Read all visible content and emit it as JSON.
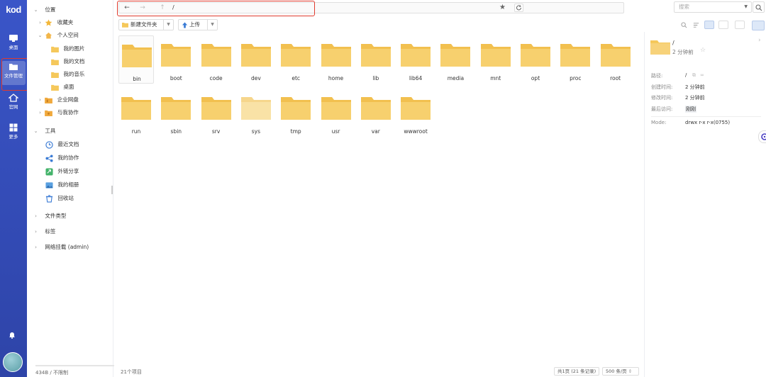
{
  "app": {
    "logo": "kod"
  },
  "rail": {
    "items": [
      {
        "label": "桌面",
        "icon": "desktop-icon"
      },
      {
        "label": "文件管理",
        "icon": "folder-icon"
      },
      {
        "label": "官网",
        "icon": "home-icon"
      },
      {
        "label": "更多",
        "icon": "grid-icon"
      }
    ]
  },
  "tree": {
    "location_label": "位置",
    "favorites": "收藏夹",
    "personal_space": "个人空间",
    "personal_children": [
      "我的图片",
      "我的文档",
      "我的音乐",
      "桌面"
    ],
    "enterprise_disk": "企业网盘",
    "shared_with_me": "与我协作",
    "tools_label": "工具",
    "tools": [
      "最近文档",
      "我的协作",
      "外链分享",
      "我的相册",
      "回收站"
    ],
    "file_types": "文件类型",
    "tags": "标签",
    "network_mount": "网络挂载 (admin)",
    "footer": "434B / 不限制"
  },
  "address": {
    "path": "/"
  },
  "toolbar": {
    "new_folder": "新建文件夹",
    "upload": "上传"
  },
  "search": {
    "placeholder": "搜索"
  },
  "folders": [
    "bin",
    "boot",
    "code",
    "dev",
    "etc",
    "home",
    "lib",
    "lib64",
    "media",
    "mnt",
    "opt",
    "proc",
    "root",
    "run",
    "sbin",
    "srv",
    "sys",
    "tmp",
    "usr",
    "var",
    "wwwroot"
  ],
  "status": {
    "item_count": "21个项目",
    "page_info": "共1页 (21 条记录)",
    "per_page": "500 条/页"
  },
  "details": {
    "name": "/",
    "modified_ago": "2 分钟前",
    "path_label": "路径:",
    "path_value": "/",
    "created_label": "创建时间:",
    "created_value": "2 分钟前",
    "modified_label": "修改时间:",
    "modified_value": "2 分钟前",
    "accessed_label": "最后访问:",
    "accessed_value": "刚刚",
    "mode_label": "Mode:",
    "mode_value": "drwx r-x r-x(0755)"
  },
  "colors": {
    "rail": "#3a55c8",
    "folder": "#f5c85b",
    "highlight": "#e03b2e"
  }
}
